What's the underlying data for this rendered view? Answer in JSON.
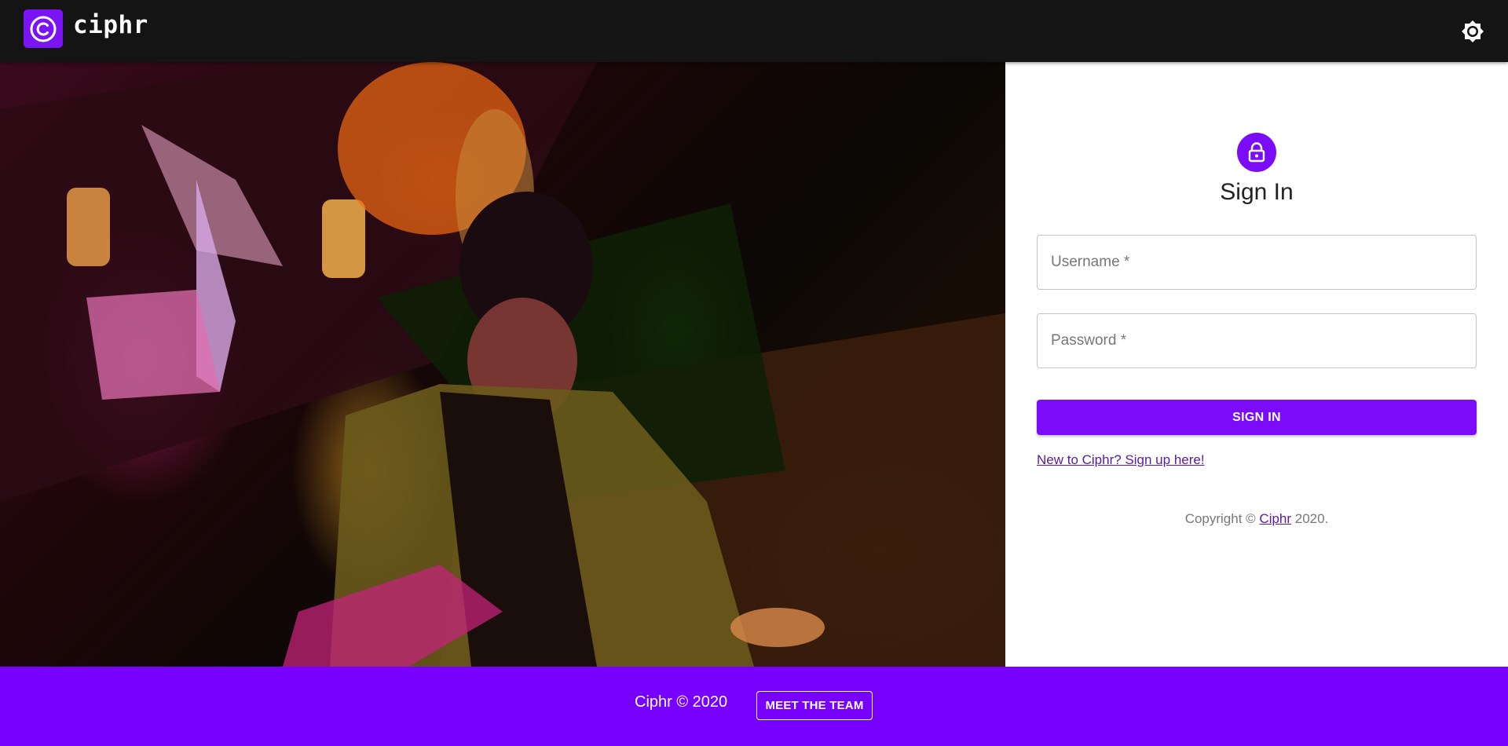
{
  "app": {
    "brand": "ciphr",
    "logo_icon": "ciphr-logo-icon",
    "theme_toggle_icon": "brightness-icon"
  },
  "colors": {
    "accent": "#7b0cf7",
    "footer_bg": "#7700ff",
    "appbar_bg": "#141414",
    "link": "#5b1a99"
  },
  "signin": {
    "avatar_icon": "lock-icon",
    "title": "Sign In",
    "username_placeholder": "Username *",
    "password_placeholder": "Password *",
    "submit_label": "SIGN IN",
    "signup_link": "New to Ciphr? Sign up here!",
    "copyright_prefix": "Copyright © ",
    "copyright_link": "Ciphr",
    "copyright_suffix": " 2020."
  },
  "hero": {
    "image_alt": "photo"
  },
  "footer": {
    "text": "Ciphr © 2020",
    "team_button": "MEET THE TEAM"
  }
}
